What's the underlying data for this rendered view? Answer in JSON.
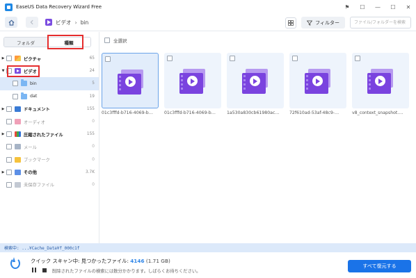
{
  "window": {
    "title": "EaseUS Data Recovery Wizard Free",
    "controls": [
      "⚑",
      "☐",
      "—",
      "☐",
      "✕"
    ]
  },
  "toolbar": {
    "breadcrumb": [
      "ビデオ",
      "bin"
    ],
    "filter_label": "フィルター",
    "search_placeholder": "ファイル/フォルダーを検索"
  },
  "sidebar": {
    "tabs": [
      "フォルダ",
      "種類"
    ],
    "items": [
      {
        "label": "ピクチャ",
        "count": "65"
      },
      {
        "label": "ビデオ",
        "count": "24"
      },
      {
        "label": "bin",
        "count": "5"
      },
      {
        "label": "dat",
        "count": "19"
      },
      {
        "label": "ドキュメント",
        "count": "155"
      },
      {
        "label": "オーディオ",
        "count": "0"
      },
      {
        "label": "圧縮されたファイル",
        "count": "155"
      },
      {
        "label": "メール",
        "count": "0"
      },
      {
        "label": "ブックマーク",
        "count": "0"
      },
      {
        "label": "その他",
        "count": "3.7K"
      },
      {
        "label": "未保存ファイル",
        "count": "0"
      }
    ]
  },
  "main": {
    "select_all": "全選択",
    "files": [
      "01c3fffd-b716-4069-b…",
      "01c3fffd-b716-4069-b…",
      "1a530a830cb61980ac…",
      "72f610ad-53af-48c9-…",
      "v8_context_snapshot.…"
    ]
  },
  "status": {
    "scanning_path": "検索中: ...¥Cache_Data¥f_000c1f"
  },
  "bottom": {
    "scan_label": "クイック スキャン中: 見つかったファイル:",
    "found_count": "4146",
    "found_size": "(1.71 GB)",
    "hint": "削除されたファイルの検索には数分かかります。しばらくお待ちください。",
    "recover_all_label": "すべて復元する"
  },
  "colors": {
    "accent": "#1a73e8",
    "highlight_box": "#e52d2d",
    "video_purple": "#7a43df"
  }
}
